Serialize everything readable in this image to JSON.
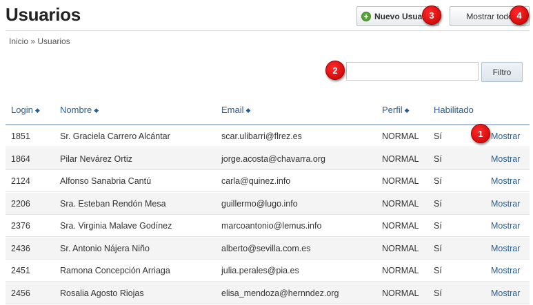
{
  "page": {
    "title": "Usuarios"
  },
  "toolbar": {
    "new_label": "Nuevo Usuario",
    "show_all_label": "Mostrar todo"
  },
  "breadcrumb": "Inicio » Usuarios",
  "filter": {
    "value": "",
    "button_label": "Filtro"
  },
  "table": {
    "headers": {
      "login": "Login",
      "name": "Nombre",
      "email": "Email",
      "profile": "Perfil",
      "enabled": "Habilitado"
    },
    "sort_glyph": "◆",
    "action_label": "Mostrar",
    "rows": [
      {
        "login": "1851",
        "name": "Sr. Graciela Carrero Alcántar",
        "email": "scar.ulibarri@flrez.es",
        "profile": "NORMAL",
        "enabled": "Sí"
      },
      {
        "login": "1864",
        "name": "Pilar Nevárez Ortiz",
        "email": "jorge.acosta@chavarra.org",
        "profile": "NORMAL",
        "enabled": "Sí"
      },
      {
        "login": "2124",
        "name": "Alfonso Sanabria Cantú",
        "email": "carla@quinez.info",
        "profile": "NORMAL",
        "enabled": "Sí"
      },
      {
        "login": "2206",
        "name": "Sra. Esteban Rendón Mesa",
        "email": "guillermo@lugo.info",
        "profile": "NORMAL",
        "enabled": "Sí"
      },
      {
        "login": "2376",
        "name": "Sra. Virginia Malave Godínez",
        "email": "marcoantonio@lemus.info",
        "profile": "NORMAL",
        "enabled": "Sí"
      },
      {
        "login": "2436",
        "name": "Sr. Antonio Nájera Niño",
        "email": "alberto@sevilla.com.es",
        "profile": "NORMAL",
        "enabled": "Sí"
      },
      {
        "login": "2451",
        "name": "Ramona Concepción Arriaga",
        "email": "julia.perales@pia.es",
        "profile": "NORMAL",
        "enabled": "Sí"
      },
      {
        "login": "2456",
        "name": "Rosalia Agosto Riojas",
        "email": "elisa_mendoza@hernndez.org",
        "profile": "NORMAL",
        "enabled": "Sí"
      }
    ]
  },
  "annotations": [
    "1",
    "2",
    "3",
    "4"
  ],
  "colors": {
    "link": "#2a5d91",
    "badge": "#d40000",
    "row_alt": "#f4f4f4",
    "header_rule": "#aac3db"
  }
}
